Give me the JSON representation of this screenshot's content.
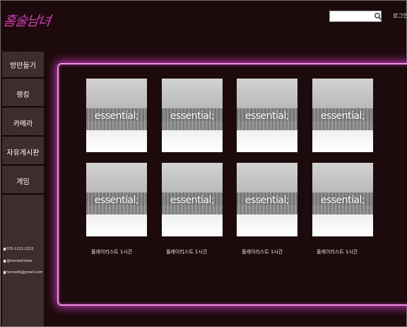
{
  "header": {
    "logo_text": "홈술남녀",
    "search_placeholder": "",
    "login_label": "로그인"
  },
  "sidebar": {
    "items": [
      {
        "label": "방만들기"
      },
      {
        "label": "랭킹"
      },
      {
        "label": "카메라"
      },
      {
        "label": "자유게시판"
      },
      {
        "label": "게임"
      }
    ],
    "contact": {
      "phone": "070-1111-2222",
      "instagram": "@homedrinker",
      "email": "homedk@gmail.com"
    }
  },
  "colors": {
    "background": "#1c0a0c",
    "sidebar": "#3e2c2e",
    "accent_glow": "#b23aa3",
    "logo": "#d23cb4"
  },
  "playlists": [
    {
      "cover_text": "essential;"
    },
    {
      "cover_text": "essential;"
    },
    {
      "cover_text": "essential;"
    },
    {
      "cover_text": "essential;"
    },
    {
      "cover_text": "essential;",
      "caption": "플레이리스트 1시간"
    },
    {
      "cover_text": "essential;",
      "caption": "플레이리스트 1시간"
    },
    {
      "cover_text": "essential;",
      "caption": "플레이리스트 1시간"
    },
    {
      "cover_text": "essential;",
      "caption": "플레이리스트 1시간"
    }
  ]
}
